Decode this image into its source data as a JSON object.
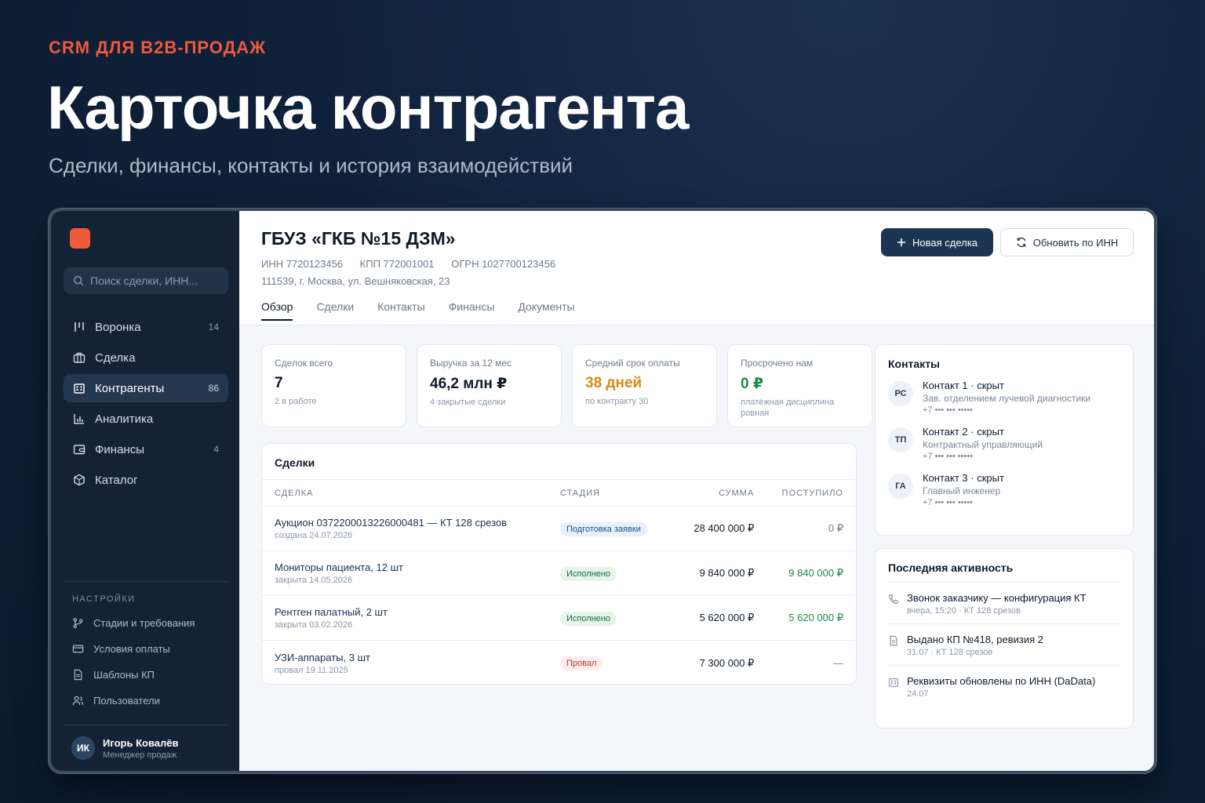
{
  "hero": {
    "kicker": "CRM ДЛЯ B2B-ПРОДАЖ",
    "title": "Карточка контрагента",
    "subtitle": "Сделки, финансы, контакты и история взаимодействий"
  },
  "sidebar": {
    "search_placeholder": "Поиск сделки, ИНН...",
    "nav": [
      {
        "label": "Воронка",
        "count": "14",
        "icon": "funnel-icon"
      },
      {
        "label": "Сделка",
        "count": "",
        "icon": "briefcase-icon"
      },
      {
        "label": "Контрагенты",
        "count": "86",
        "icon": "building-icon"
      },
      {
        "label": "Аналитика",
        "count": "",
        "icon": "chart-icon"
      },
      {
        "label": "Финансы",
        "count": "4",
        "icon": "wallet-icon"
      },
      {
        "label": "Каталог",
        "count": "",
        "icon": "box-icon"
      }
    ],
    "settings_title": "НАСТРОЙКИ",
    "settings": [
      {
        "label": "Стадии и требования",
        "icon": "branch-icon"
      },
      {
        "label": "Условия оплаты",
        "icon": "card-icon"
      },
      {
        "label": "Шаблоны КП",
        "icon": "document-icon"
      },
      {
        "label": "Пользователи",
        "icon": "users-icon"
      }
    ],
    "user": {
      "initials": "ИК",
      "name": "Игорь Ковалёв",
      "role": "Менеджер продаж"
    }
  },
  "org": {
    "title": "ГБУЗ «ГКБ №15 ДЗМ»",
    "inn": "ИНН 7720123456",
    "kpp": "КПП 772001001",
    "ogrn": "ОГРН 1027700123456",
    "address": "111539, г. Москва, ул. Вешняковская, 23",
    "new_deal_label": "Новая сделка",
    "refresh_label": "Обновить по ИНН"
  },
  "tabs": [
    "Обзор",
    "Сделки",
    "Контакты",
    "Финансы",
    "Документы"
  ],
  "kpis": [
    {
      "label": "Сделок всего",
      "value": "7",
      "note": "2 в работе",
      "color": "#0e1a2b"
    },
    {
      "label": "Выручка за 12 мес",
      "value": "46,2 млн ₽",
      "note": "4 закрытые сделки",
      "color": "#0e1a2b"
    },
    {
      "label": "Средний срок оплаты",
      "value": "38 дней",
      "note": "по контракту 30",
      "color": "#d98a12"
    },
    {
      "label": "Просрочено нам",
      "value": "0 ₽",
      "note": "платёжная дисциплина ровная",
      "color": "#1a8a46"
    }
  ],
  "deals": {
    "title": "Сделки",
    "headers": {
      "deal": "СДЕЛКА",
      "stage": "СТАДИЯ",
      "sum": "СУММА",
      "paid": "ПОСТУПИЛО"
    },
    "rows": [
      {
        "name": "Аукцион 0372200013226000481 — КТ 128 срезов",
        "sub": "создана 24.07.2026",
        "stage": "Подготовка заявки",
        "stage_bg": "#e7f0fb",
        "stage_fg": "#1f4f85",
        "sum": "28 400 000 ₽",
        "paid": "0 ₽",
        "paid_class": ""
      },
      {
        "name": "Мониторы пациента, 12 шт",
        "sub": "закрыта 14.05.2026",
        "stage": "Исполнено",
        "stage_bg": "#e6f4ea",
        "stage_fg": "#1b6b3a",
        "sum": "9 840 000 ₽",
        "paid": "9 840 000 ₽",
        "paid_class": "paid-green"
      },
      {
        "name": "Рентген палатный, 2 шт",
        "sub": "закрыта 03.02.2026",
        "stage": "Исполнено",
        "stage_bg": "#e6f4ea",
        "stage_fg": "#1b6b3a",
        "sum": "5 620 000 ₽",
        "paid": "5 620 000 ₽",
        "paid_class": "paid-green"
      },
      {
        "name": "УЗИ-аппараты, 3 шт",
        "sub": "провал 19.11.2025",
        "stage": "Провал",
        "stage_bg": "#fdecec",
        "stage_fg": "#c0392b",
        "sum": "7 300 000 ₽",
        "paid": "—",
        "paid_class": ""
      }
    ]
  },
  "contacts": {
    "title": "Контакты",
    "items": [
      {
        "initials": "РС",
        "name": "Контакт 1 · скрыт",
        "role": "Зав. отделением лучевой диагностики",
        "phone": "+7 ••• ••• •••••"
      },
      {
        "initials": "ТП",
        "name": "Контакт 2 · скрыт",
        "role": "Контрактный управляющий",
        "phone": "+7 ••• ••• •••••"
      },
      {
        "initials": "ГА",
        "name": "Контакт 3 · скрыт",
        "role": "Главный инженер",
        "phone": "+7 ••• ••• •••••"
      }
    ]
  },
  "activity": {
    "title": "Последняя активность",
    "items": [
      {
        "title": "Звонок заказчику — конфигурация КТ",
        "sub": "вчера, 15:20 · КТ 128 срезов",
        "icon": "phone-icon"
      },
      {
        "title": "Выдано КП №418, ревизия 2",
        "sub": "31.07 · КТ 128 срезов",
        "icon": "document-icon"
      },
      {
        "title": "Реквизиты обновлены по ИНН (DaData)",
        "sub": "24.07",
        "icon": "building-icon"
      }
    ]
  }
}
